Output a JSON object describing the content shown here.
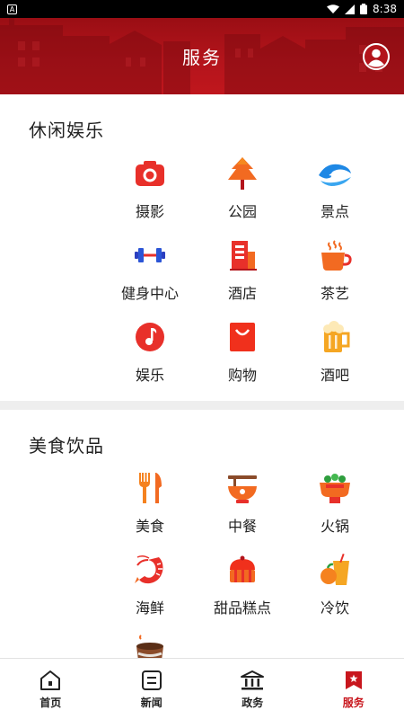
{
  "status": {
    "time": "8:38",
    "notification": "A"
  },
  "header": {
    "title": "服务"
  },
  "sections": [
    {
      "title": "休闲娱乐",
      "items": [
        {
          "label": "摄影",
          "icon": "camera-icon"
        },
        {
          "label": "公园",
          "icon": "tree-icon"
        },
        {
          "label": "景点",
          "icon": "scenic-wave-icon"
        },
        {
          "label": "健身中心",
          "icon": "dumbbell-icon"
        },
        {
          "label": "酒店",
          "icon": "building-icon"
        },
        {
          "label": "茶艺",
          "icon": "tea-cup-icon"
        },
        {
          "label": "娱乐",
          "icon": "music-note-icon"
        },
        {
          "label": "购物",
          "icon": "shopping-bag-icon"
        },
        {
          "label": "酒吧",
          "icon": "beer-mug-icon"
        }
      ]
    },
    {
      "title": "美食饮品",
      "items": [
        {
          "label": "美食",
          "icon": "fork-knife-icon"
        },
        {
          "label": "中餐",
          "icon": "noodle-bowl-icon"
        },
        {
          "label": "火锅",
          "icon": "hotpot-icon"
        },
        {
          "label": "海鲜",
          "icon": "shrimp-icon"
        },
        {
          "label": "甜品糕点",
          "icon": "cake-icon"
        },
        {
          "label": "冷饮",
          "icon": "juice-icon"
        },
        {
          "label": "",
          "icon": "coffee-cup-icon"
        }
      ]
    }
  ],
  "tabbar": {
    "active": "服务",
    "tabs": [
      {
        "label": "首页",
        "icon": "home-icon"
      },
      {
        "label": "新闻",
        "icon": "news-icon"
      },
      {
        "label": "政务",
        "icon": "government-icon"
      },
      {
        "label": "服务",
        "icon": "service-icon"
      }
    ]
  },
  "colors": {
    "brand_red": "#c8161d",
    "icon_orange": "#f5821f",
    "icon_blue": "#2b6cd6"
  }
}
